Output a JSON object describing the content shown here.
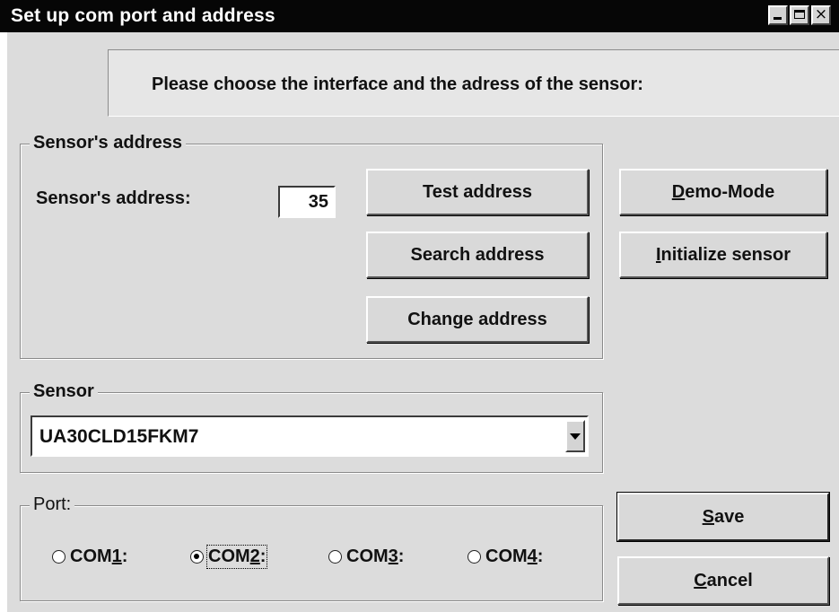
{
  "window": {
    "title": "Set up com port and address"
  },
  "header": {
    "text": "Please choose the interface and the adress of the sensor:"
  },
  "address_group": {
    "legend": "Sensor's address",
    "field_label": "Sensor's address:",
    "field_value": "35",
    "buttons": {
      "test": "Test address",
      "search": "Search address",
      "change": "Change address"
    }
  },
  "right_buttons": {
    "demo": {
      "accel": "D",
      "rest": "emo-Mode"
    },
    "init": {
      "accel": "I",
      "rest": "nitialize sensor"
    }
  },
  "sensor_group": {
    "legend": "Sensor",
    "selected": "UA30CLD15FKM7"
  },
  "port_group": {
    "legend": "Port:",
    "options": [
      {
        "pre": "COM",
        "accel": "1",
        "post": ":",
        "selected": false
      },
      {
        "pre": "COM",
        "accel": "2",
        "post": ":",
        "selected": true
      },
      {
        "pre": "COM",
        "accel": "3",
        "post": ":",
        "selected": false
      },
      {
        "pre": "COM",
        "accel": "4",
        "post": ":",
        "selected": false
      }
    ]
  },
  "dialog_buttons": {
    "save": {
      "accel": "S",
      "rest": "ave"
    },
    "cancel": {
      "accel": "C",
      "rest": "ancel"
    }
  },
  "icons": [
    "minimize-icon",
    "maximize-icon",
    "close-icon",
    "dropdown-arrow-icon"
  ]
}
